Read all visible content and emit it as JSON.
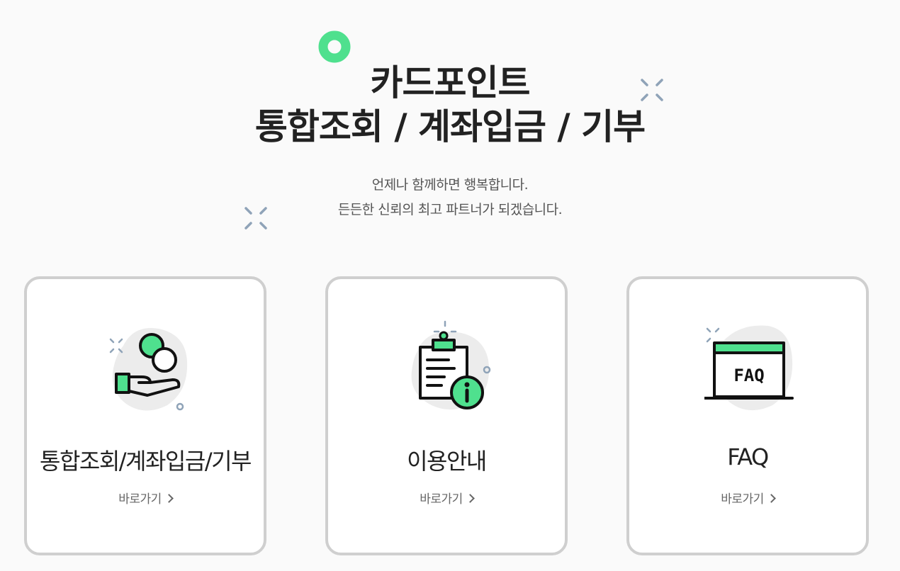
{
  "hero": {
    "title_line1": "카드포인트",
    "title_line2": "통합조회 / 계좌입금 / 기부",
    "subtitle_line1": "언제나 함께하면 행복합니다.",
    "subtitle_line2": "든든한 신뢰의 최고 파트너가 되겠습니다."
  },
  "cards": [
    {
      "title": "통합조회/계좌입금/기부",
      "link": "바로가기",
      "icon": "hand-coins-icon"
    },
    {
      "title": "이용안내",
      "link": "바로가기",
      "icon": "clipboard-info-icon"
    },
    {
      "title": "FAQ",
      "link": "바로가기",
      "icon": "faq-window-icon",
      "icon_text": "FAQ"
    }
  ],
  "colors": {
    "accent": "#4fe08e",
    "text": "#222222",
    "subtext": "#555555",
    "card_border": "#cfcfcf",
    "sparkle": "#8fa3b8",
    "blob": "#ececec"
  }
}
